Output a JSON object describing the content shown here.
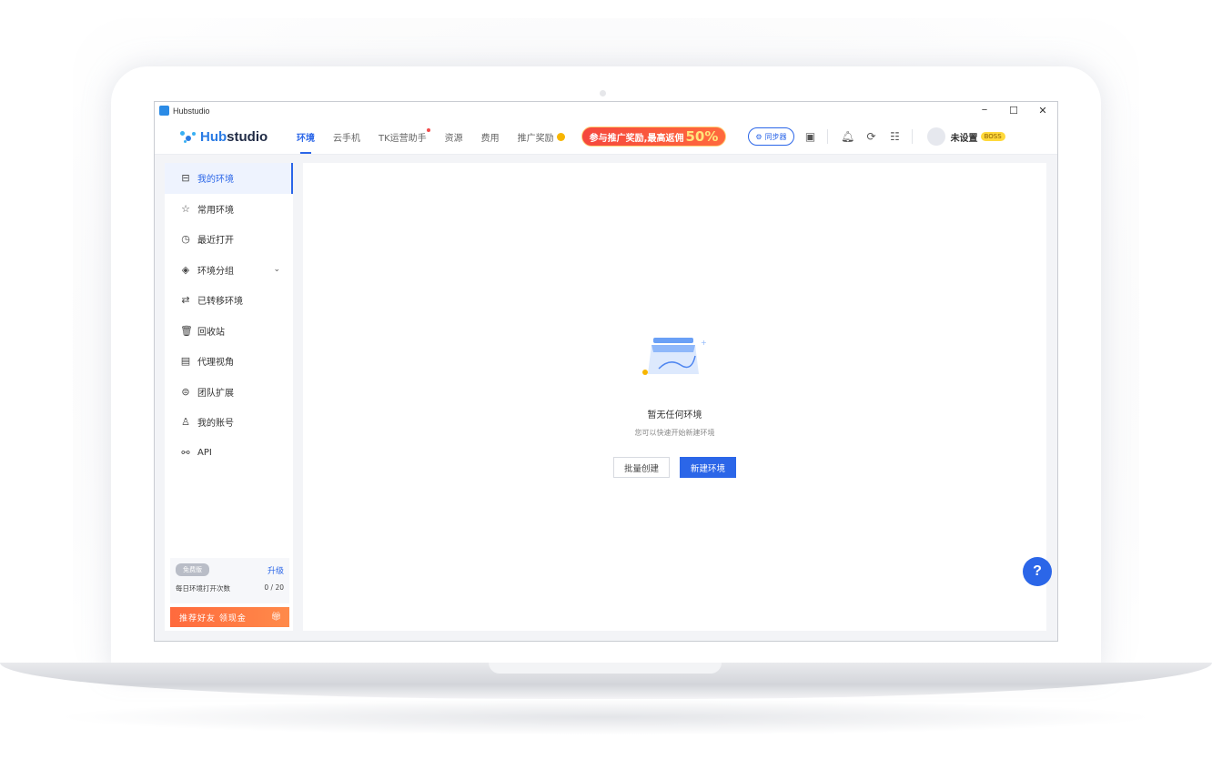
{
  "window": {
    "title": "Hubstudio",
    "controls": {
      "minimize": "−",
      "maximize": "☐",
      "close": "✕"
    }
  },
  "header": {
    "brand": {
      "prefix": "Hub",
      "suffix": "studio"
    },
    "nav": [
      {
        "label": "环境",
        "active": true
      },
      {
        "label": "云手机"
      },
      {
        "label": "TK运营助手",
        "badge": "red-dot"
      },
      {
        "label": "资源"
      },
      {
        "label": "费用"
      },
      {
        "label": "推广奖励",
        "icon": "coin-icon"
      }
    ],
    "promo": {
      "text": "参与推广奖励,最高返佣",
      "highlight": "50%"
    },
    "sync_label": "同步器",
    "user": {
      "name": "未设置",
      "badge": "BOSS"
    }
  },
  "sidebar": {
    "items": [
      {
        "label": "我的环境",
        "icon": "browser-icon",
        "active": true
      },
      {
        "label": "常用环境",
        "icon": "star-icon"
      },
      {
        "label": "最近打开",
        "icon": "clock-icon"
      },
      {
        "label": "环境分组",
        "icon": "layers-icon",
        "expandable": true
      },
      {
        "label": "已转移环境",
        "icon": "transfer-icon"
      },
      {
        "label": "回收站",
        "icon": "trash-icon"
      },
      {
        "label": "代理视角",
        "icon": "proxy-icon"
      },
      {
        "label": "团队扩展",
        "icon": "extension-icon"
      },
      {
        "label": "我的账号",
        "icon": "user-icon"
      },
      {
        "label": "API",
        "icon": "api-icon"
      }
    ],
    "plan": {
      "tier": "免费版",
      "upgrade": "升级",
      "daily_label": "每日环境打开次数",
      "daily_value": "0 / 20"
    },
    "referral": "推荐好友 领现金"
  },
  "main": {
    "empty_title": "暂无任何环境",
    "empty_subtitle": "您可以快速开始新建环境",
    "batch_create": "批量创建",
    "new_env": "新建环境",
    "help": "?"
  }
}
